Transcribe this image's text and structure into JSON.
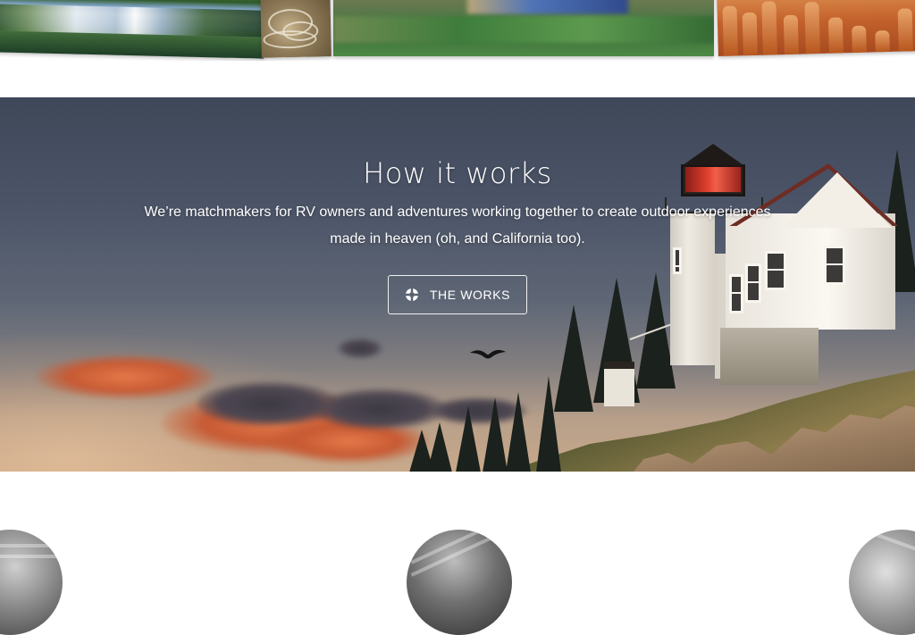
{
  "hero": {
    "title": "How it works",
    "subtitle": "We’re matchmakers for RV owners and adventures working together to create outdoor experiences made in heaven (oh, and California too).",
    "button": {
      "label": "THE WORKS",
      "icon": "lifebuoy-icon"
    }
  },
  "photo_strip": {
    "photos": [
      "mountain-lake-reflection",
      "dry-branches",
      "blurred-valley",
      "red-rock-hoodoos"
    ]
  },
  "testimonials": {
    "avatars": [
      "person-photo",
      "rock-formation-photo",
      "person-photo"
    ]
  },
  "colors": {
    "hero_text": "#ffffff",
    "page_background": "#ffffff",
    "lighthouse_lamp": "#e0402e"
  }
}
